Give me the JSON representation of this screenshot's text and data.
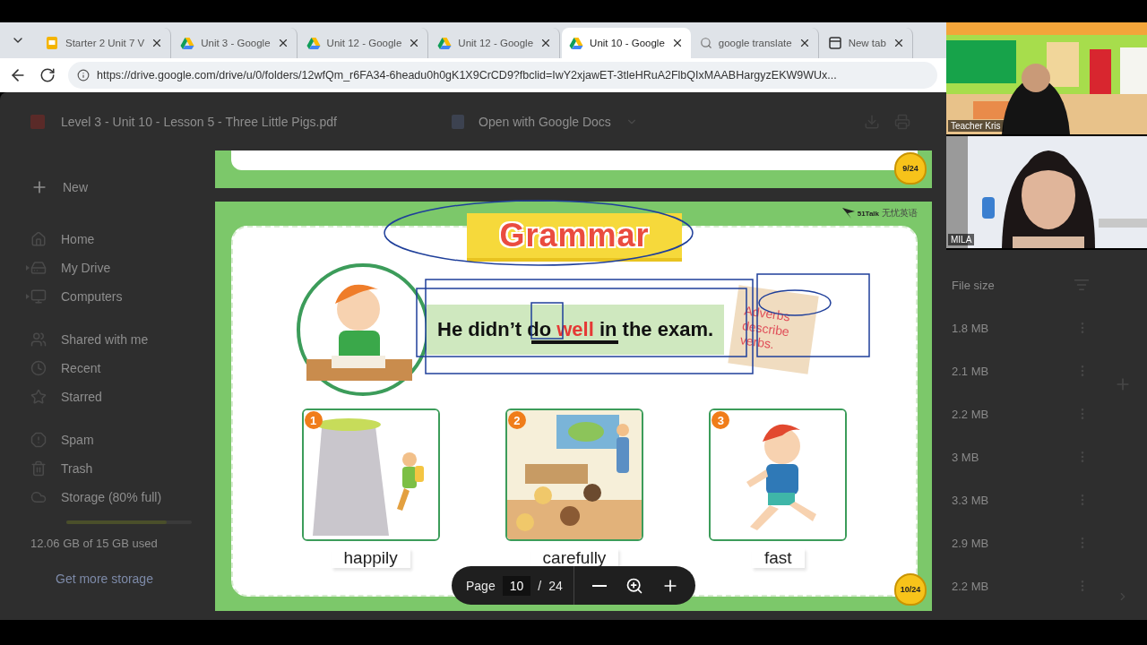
{
  "browser": {
    "tabs": [
      {
        "title": "Starter 2 Unit 7 V",
        "kind": "slides",
        "selected": false
      },
      {
        "title": "Unit 3 - Google",
        "kind": "drive",
        "selected": false
      },
      {
        "title": "Unit 12 - Google",
        "kind": "drive",
        "selected": false
      },
      {
        "title": "Unit 12 - Google",
        "kind": "drive",
        "selected": false
      },
      {
        "title": "Unit 10 - Google",
        "kind": "drive",
        "selected": true
      },
      {
        "title": "google translate",
        "kind": "search",
        "selected": false
      },
      {
        "title": "New tab",
        "kind": "newtab",
        "selected": false
      }
    ],
    "url": "https://drive.google.com/drive/u/0/folders/12wfQm_r6FA34-6headu0h0gK1X9CrCD9?fbclid=IwY2xjawET-3tleHRuA2FlbQIxMAABHargyzEKW9WUx..."
  },
  "drive": {
    "file_title": "Level 3 - Unit 10 - Lesson 5 - Three Little Pigs.pdf",
    "open_with": "Open with Google Docs",
    "new_label": "New",
    "sidebar_groups": [
      [
        {
          "label": "Home",
          "kind": "home"
        },
        {
          "label": "My Drive",
          "kind": "drive",
          "expanded": false
        },
        {
          "label": "Computers",
          "kind": "computer",
          "expanded": false
        }
      ],
      [
        {
          "label": "Shared with me",
          "kind": "shared"
        },
        {
          "label": "Recent",
          "kind": "recent"
        },
        {
          "label": "Starred",
          "kind": "star"
        }
      ],
      [
        {
          "label": "Spam",
          "kind": "spam"
        },
        {
          "label": "Trash",
          "kind": "trash"
        },
        {
          "label": "Storage (80% full)",
          "kind": "cloud"
        }
      ]
    ],
    "storage": {
      "level": 0.8
    },
    "storage_used": "12.06 GB of 15 GB used",
    "get_more": "Get more storage",
    "file_size_header": "File size",
    "file_sizes": [
      "1.8 MB",
      "2.1 MB",
      "2.2 MB",
      "3 MB",
      "3.3 MB",
      "2.9 MB",
      "2.2 MB"
    ]
  },
  "pdf": {
    "pages": [
      {
        "badge": "9/24"
      },
      {
        "badge": "10/24"
      }
    ],
    "slide": {
      "logo": "51Talk",
      "logo_sub": "无忧英语",
      "title": "Grammar",
      "sentence": "He didn’t do **well** in the exam.",
      "note": "Adverbs describe verbs.",
      "cards": [
        {
          "number": "1",
          "label": "happily"
        },
        {
          "number": "2",
          "label": "carefully"
        },
        {
          "number": "3",
          "label": "fast"
        }
      ]
    },
    "toolbar": {
      "page_label": "Page",
      "page": "10",
      "separator": "/",
      "total": "24"
    }
  },
  "video": [
    {
      "name": "Teacher Kris"
    },
    {
      "name": "MILA"
    }
  ]
}
